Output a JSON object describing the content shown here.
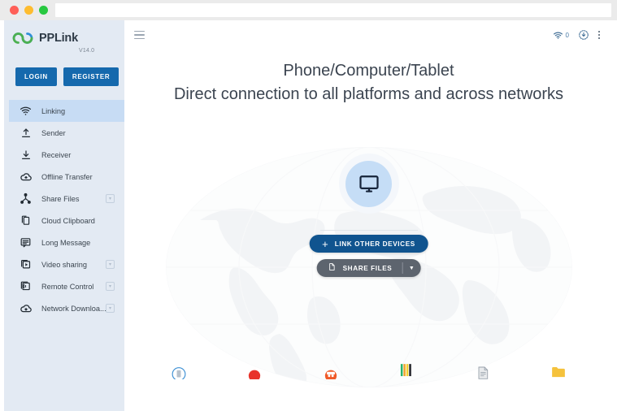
{
  "window": {
    "traffic_lights": [
      "close",
      "minimize",
      "maximize"
    ],
    "url_bar_value": ""
  },
  "sidebar": {
    "brand": {
      "name": "PPLink",
      "version": "V14.0",
      "logo_icon": "pplink-logo-icon"
    },
    "auth": {
      "login_label": "LOGIN",
      "register_label": "REGISTER"
    },
    "items": [
      {
        "label": "Linking",
        "icon": "wifi-icon",
        "active": true,
        "expandable": false
      },
      {
        "label": "Sender",
        "icon": "upload-icon",
        "active": false,
        "expandable": false
      },
      {
        "label": "Receiver",
        "icon": "download-icon",
        "active": false,
        "expandable": false
      },
      {
        "label": "Offline Transfer",
        "icon": "cloud-icon",
        "active": false,
        "expandable": false
      },
      {
        "label": "Share Files",
        "icon": "share-nodes-icon",
        "active": false,
        "expandable": true
      },
      {
        "label": "Cloud Clipboard",
        "icon": "clipboard-copy-icon",
        "active": false,
        "expandable": false
      },
      {
        "label": "Long Message",
        "icon": "message-lines-icon",
        "active": false,
        "expandable": false
      },
      {
        "label": "Video sharing",
        "icon": "video-play-icon",
        "active": false,
        "expandable": true
      },
      {
        "label": "Remote Control",
        "icon": "remote-cast-icon",
        "active": false,
        "expandable": true
      },
      {
        "label": "Network Downloa...",
        "icon": "cloud-download-icon",
        "active": false,
        "expandable": true
      }
    ]
  },
  "main": {
    "topbar": {
      "menu_icon": "hamburger-icon",
      "wifi_icon": "wifi-icon",
      "wifi_count": "0",
      "download_icon": "download-circle-icon",
      "more_icon": "kebab-menu-icon"
    },
    "headline": {
      "line1": "Phone/Computer/Tablet",
      "line2": "Direct connection to all platforms and across networks"
    },
    "device": {
      "icon": "monitor-icon"
    },
    "actions": {
      "link_devices_label": "LINK OTHER DEVICES",
      "link_devices_icon": "plus-icon",
      "share_files_label": "SHARE FILES",
      "share_files_icon": "file-icon",
      "share_files_caret_icon": "chevron-down-icon"
    },
    "app_strip": [
      {
        "icon": "blue-book-app-icon"
      },
      {
        "icon": "red-circle-app-icon"
      },
      {
        "icon": "orange-face-app-icon"
      },
      {
        "icon": "color-bars-app-icon"
      },
      {
        "icon": "gray-document-app-icon"
      },
      {
        "icon": "yellow-folder-app-icon"
      }
    ]
  },
  "colors": {
    "brand_blue": "#1569ad",
    "action_blue": "#10548f",
    "share_gray": "#5d646e",
    "sidebar_bg": "#e3eaf3",
    "active_nav_bg": "#c7dcf4",
    "device_circle": "#c5ddf6"
  }
}
